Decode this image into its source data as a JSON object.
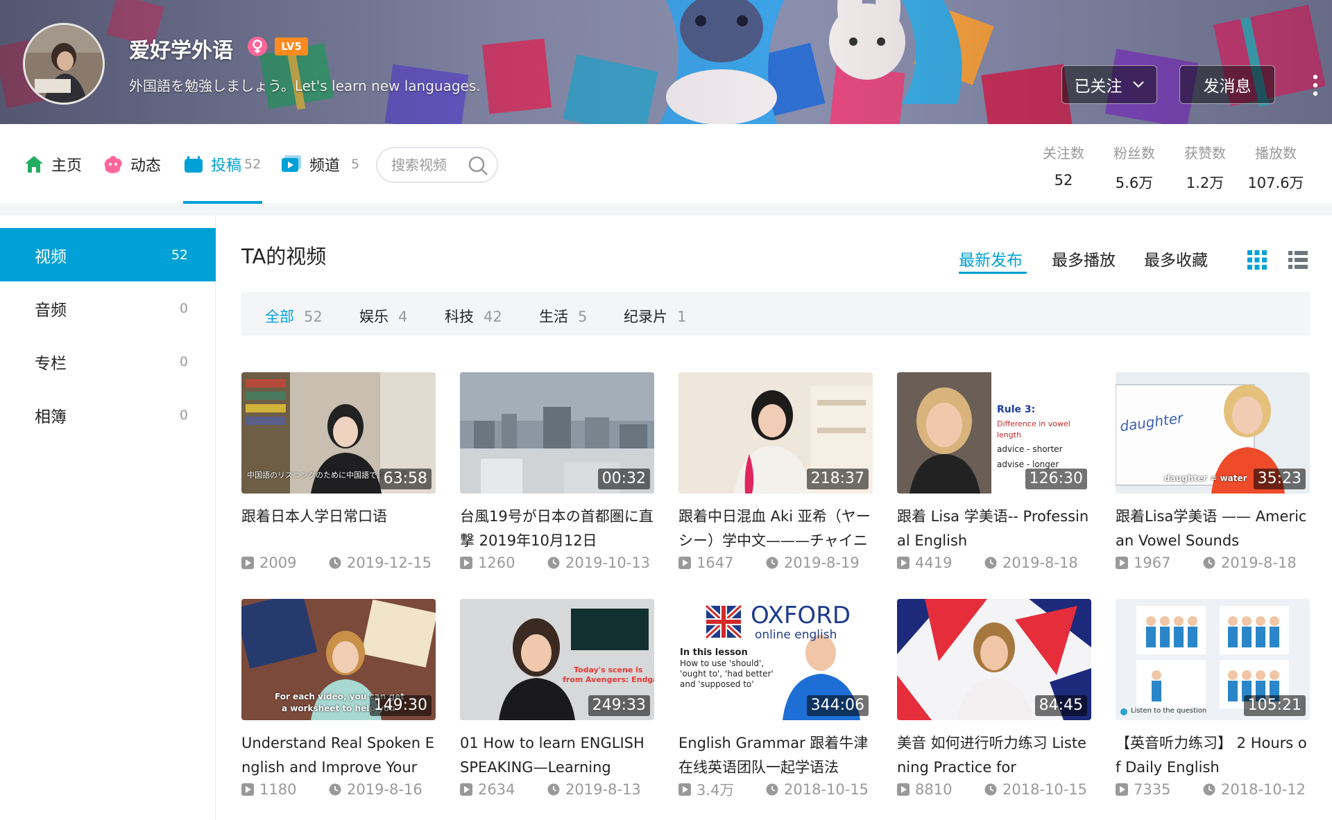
{
  "profile": {
    "username": "爱好学外语",
    "level": "LV5",
    "signature": "外国語を勉強しましょう。Let's learn new languages.",
    "follow_button": "已关注",
    "message_button": "发消息",
    "gender_icon": "female-icon"
  },
  "nav": {
    "home": "主页",
    "dynamic": "动态",
    "uploads": "投稿",
    "uploads_count": "52",
    "channels": "频道",
    "channels_count": "5",
    "search_placeholder": "搜索视频"
  },
  "stats": [
    {
      "label": "关注数",
      "value": "52"
    },
    {
      "label": "粉丝数",
      "value": "5.6万"
    },
    {
      "label": "获赞数",
      "value": "1.2万"
    },
    {
      "label": "播放数",
      "value": "107.6万"
    }
  ],
  "sidebar": [
    {
      "label": "视频",
      "count": "52"
    },
    {
      "label": "音频",
      "count": "0"
    },
    {
      "label": "专栏",
      "count": "0"
    },
    {
      "label": "相簿",
      "count": "0"
    }
  ],
  "main": {
    "title": "TA的视频",
    "sort": [
      "最新发布",
      "最多播放",
      "最多收藏"
    ]
  },
  "filters": [
    {
      "label": "全部",
      "count": "52"
    },
    {
      "label": "娱乐",
      "count": "4"
    },
    {
      "label": "科技",
      "count": "42"
    },
    {
      "label": "生活",
      "count": "5"
    },
    {
      "label": "纪录片",
      "count": "1"
    }
  ],
  "videos": [
    {
      "title": "跟着日本人学日常口语",
      "duration": "63:58",
      "plays": "2009",
      "date": "2019-12-15"
    },
    {
      "title": "台風19号が日本の首都圏に直撃 2019年10月12日",
      "duration": "00:32",
      "plays": "1260",
      "date": "2019-10-13"
    },
    {
      "title": "跟着中日混血 Aki 亚希（ヤーシー）学中文———チャイニ",
      "duration": "218:37",
      "plays": "1647",
      "date": "2019-8-19"
    },
    {
      "title": "跟着 Lisa 学美语-- Professinal English",
      "duration": "126:30",
      "plays": "4419",
      "date": "2019-8-18"
    },
    {
      "title": "跟着Lisa学美语 —— American Vowel Sounds",
      "duration": "35:23",
      "plays": "1967",
      "date": "2019-8-18"
    },
    {
      "title": "Understand Real Spoken English and Improve Your",
      "duration": "149:30",
      "plays": "1180",
      "date": "2019-8-16"
    },
    {
      "title": "01 How to learn ENGLISH SPEAKING—Learning",
      "duration": "249:33",
      "plays": "2634",
      "date": "2019-8-13"
    },
    {
      "title": "English Grammar 跟着牛津在线英语团队一起学语法",
      "duration": "344:06",
      "plays": "3.4万",
      "date": "2018-10-15"
    },
    {
      "title": "美音 如何进行听力练习 Listening Practice for",
      "duration": "84:45",
      "plays": "8810",
      "date": "2018-10-15"
    },
    {
      "title": "【英音听力练习】 2 Hours of Daily English",
      "duration": "105:21",
      "plays": "7335",
      "date": "2018-10-12"
    }
  ],
  "thumb_text": {
    "t1_caption": "中国語のリスニングのために中国語で話します",
    "t4_rule": "Rule 3:",
    "t4_line1": "Difference in vowel",
    "t4_line2": "length",
    "t4_line3": "advice - shorter",
    "t4_line4": "advise - longer",
    "t5_word": "daughter",
    "t5_caption": "daughter = water",
    "t6_caption1": "For each video, you can get",
    "t6_caption2": "a worksheet to help you",
    "t7_caption1": "Today's scene is",
    "t7_caption2": "from Avengers: Endgame",
    "t8_brand": "OXFORD",
    "t8_sub": "online english",
    "t8_lesson": "In this lesson",
    "t8_l1": "How to use 'should',",
    "t8_l2": "'ought to', 'had better'",
    "t8_l3": "and 'supposed to'",
    "t10_caption": "Listen to the question"
  },
  "colors": {
    "accent": "#00a1d6",
    "level_badge": "#ff8a1f",
    "home_icon": "#23ad62",
    "dynamic_icon": "#ff6699"
  }
}
